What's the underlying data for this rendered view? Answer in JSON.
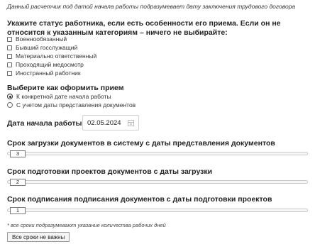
{
  "intro_text": "Данный расчетчик под датой начала работы подразумевает дату заключения трудового договора",
  "status": {
    "title": "Укажите статус работника, если есть особенности его приема. Если он не относится к указанным категориям – ничего не выбирайте:",
    "options": [
      {
        "label": "Военнообязанный",
        "checked": false
      },
      {
        "label": "Бывший госслужащий",
        "checked": false
      },
      {
        "label": "Материально ответственный",
        "checked": false
      },
      {
        "label": "Проходящий медосмотр",
        "checked": false
      },
      {
        "label": "Иностранный работник",
        "checked": false
      }
    ]
  },
  "mode": {
    "title": "Выберите как оформить прием",
    "options": [
      {
        "label": "К конкретной дате начала работы",
        "selected": true
      },
      {
        "label": "С учетом даты представления документов",
        "selected": false
      }
    ]
  },
  "start_date": {
    "label": "Дата начала работы",
    "value": "02.05.2024"
  },
  "sliders": [
    {
      "title": "Срок загрузки документов в систему с даты представления документов",
      "value": "3"
    },
    {
      "title": "Срок подготовки проектов документов с даты загрузки",
      "value": "2"
    },
    {
      "title": "Срок подписания подписания документов с даты подготовки проектов",
      "value": "1"
    }
  ],
  "footnote": "* все сроки подразумевают указание количества рабочих дней",
  "not_important_button": "Все сроки не важны"
}
